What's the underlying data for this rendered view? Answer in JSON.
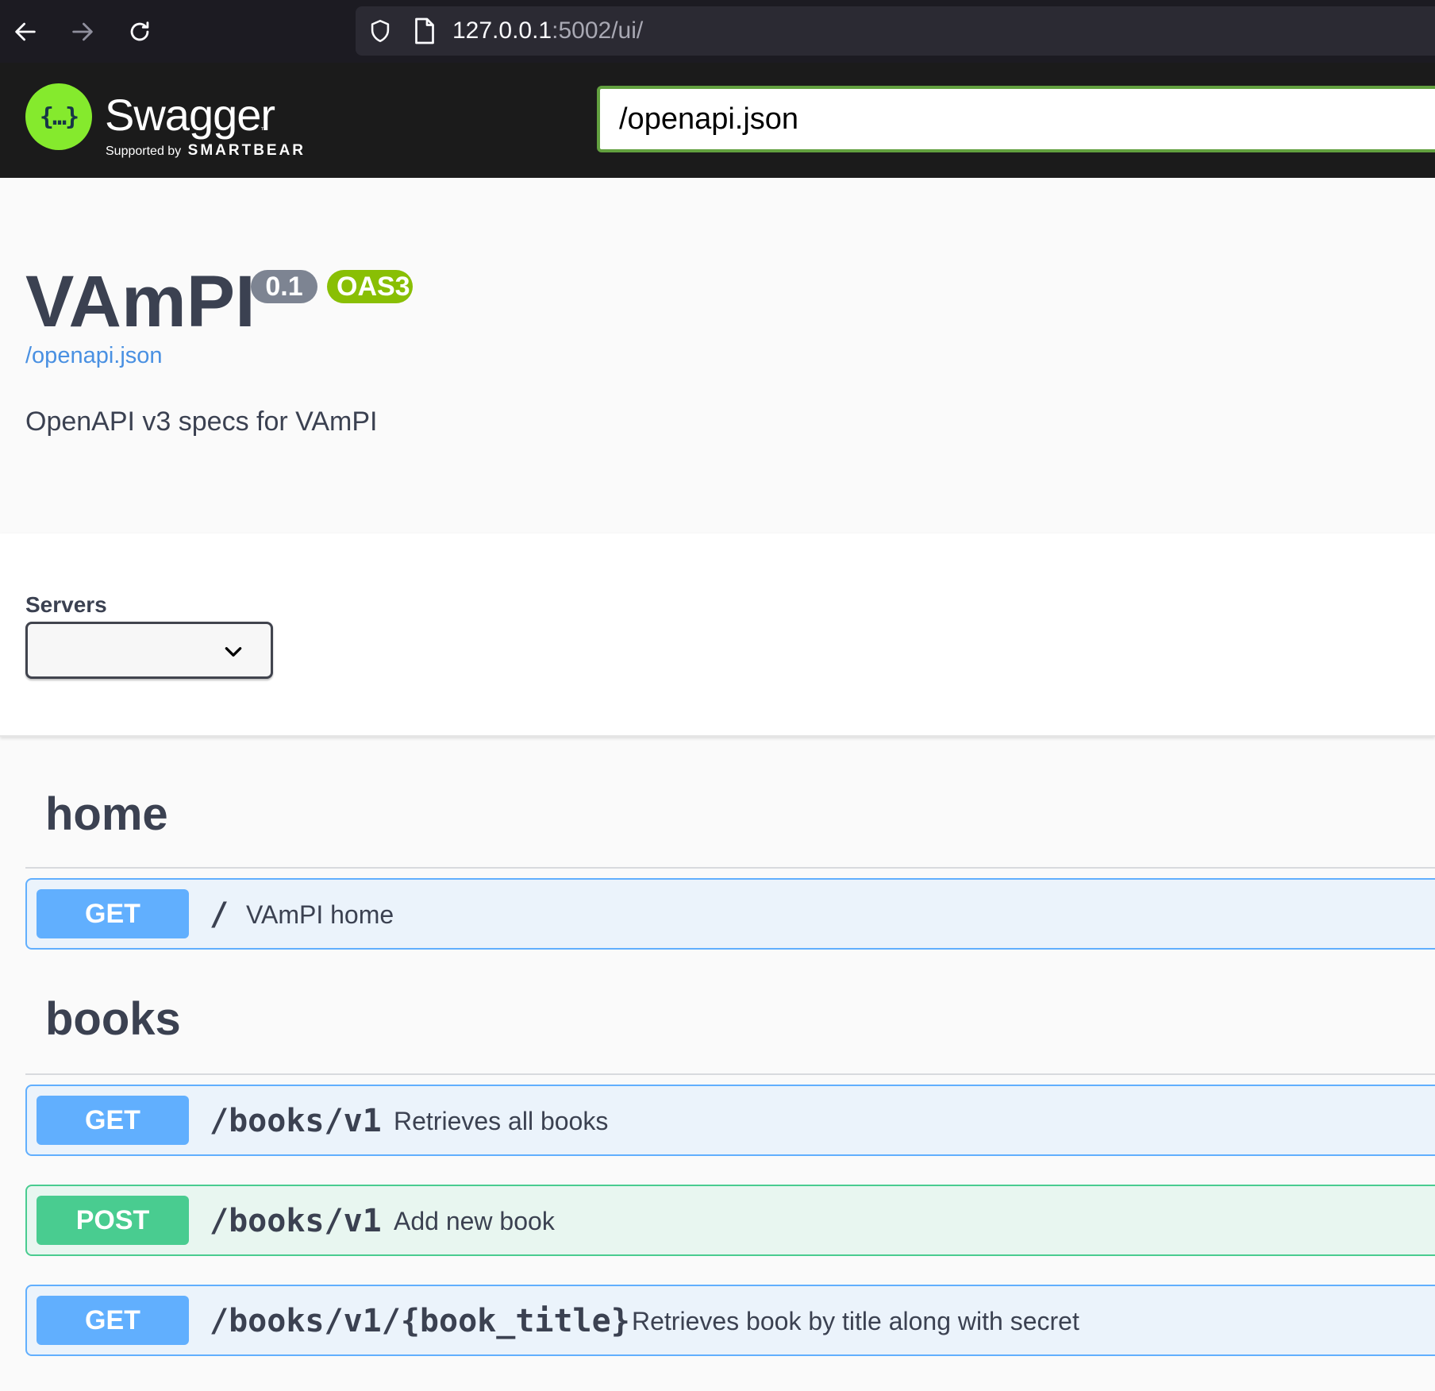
{
  "browser": {
    "url_host": "127.0.0.1",
    "url_rest": ":5002/ui/"
  },
  "topbar": {
    "logo_symbol": "{…}",
    "logo_title": "Swagger",
    "logo_tm": "™",
    "supported_by": "Supported by",
    "smartbear": "SMARTBEAR",
    "spec_url_value": "/openapi.json"
  },
  "info": {
    "title": "VAmPI",
    "version": "0.1",
    "oas_badge": "OAS3",
    "spec_link": "/openapi.json",
    "description": "OpenAPI v3 specs for VAmPI"
  },
  "servers": {
    "label": "Servers",
    "selected": ""
  },
  "tags": [
    {
      "name": "home",
      "operations": [
        {
          "method": "GET",
          "path": "/",
          "summary": "VAmPI home"
        }
      ]
    },
    {
      "name": "books",
      "operations": [
        {
          "method": "GET",
          "path": "/books/v1",
          "summary": "Retrieves all books"
        },
        {
          "method": "POST",
          "path": "/books/v1",
          "summary": "Add new book"
        },
        {
          "method": "GET",
          "path": "/books/v1/{book_title}",
          "summary": "Retrieves book by title along with secret"
        }
      ]
    }
  ],
  "colors": {
    "get": "#61affe",
    "post": "#49cc90",
    "swagger_green": "#85ea2d",
    "oas_badge": "#89bf04",
    "version_badge": "#7d8492"
  },
  "icons": [
    "back-arrow-icon",
    "forward-arrow-icon",
    "reload-icon",
    "shield-icon",
    "page-icon",
    "chevron-down-icon"
  ]
}
